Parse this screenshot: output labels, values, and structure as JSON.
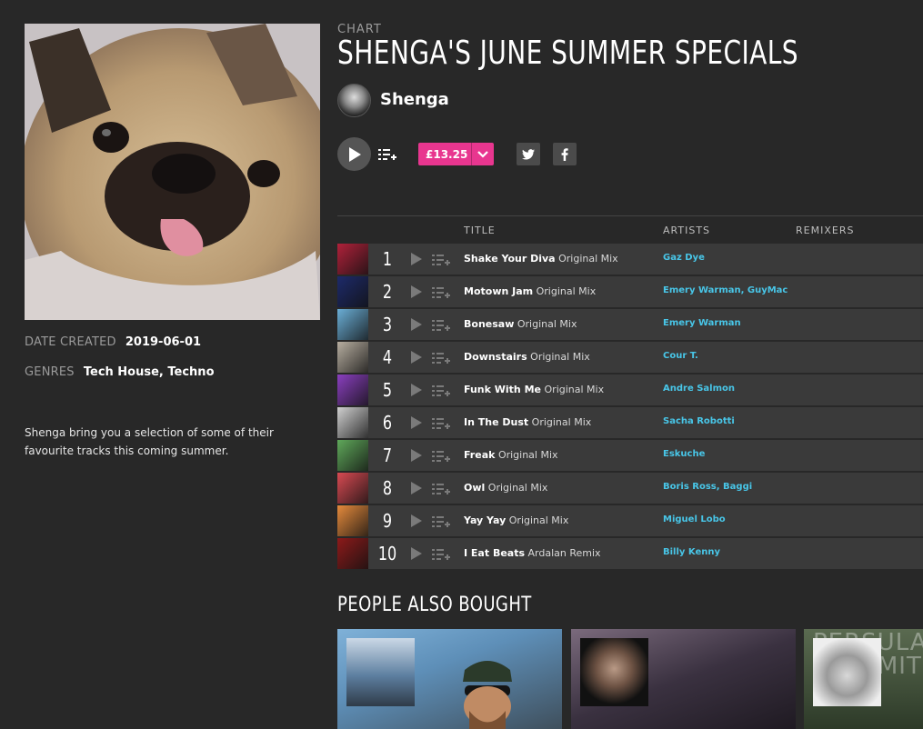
{
  "chart": {
    "kicker": "CHART",
    "title": "SHENGA'S JUNE SUMMER SPECIALS",
    "curator": "Shenga",
    "price": "£13.25"
  },
  "meta": {
    "date_label": "DATE CREATED",
    "date_value": "2019-06-01",
    "genres_label": "GENRES",
    "genres_value": "Tech House, Techno",
    "description": "Shenga bring you a selection of some of their favourite tracks this coming summer."
  },
  "columns": {
    "title": "TITLE",
    "artists": "ARTISTS",
    "remixers": "REMIXERS"
  },
  "tracks": [
    {
      "num": "1",
      "name": "Shake Your Diva",
      "mix": "Original Mix",
      "artists": "Gaz Dye",
      "thumb": "#b0213a"
    },
    {
      "num": "2",
      "name": "Motown Jam",
      "mix": "Original Mix",
      "artists": "Emery Warman, GuyMac",
      "thumb": "#1d2a6a"
    },
    {
      "num": "3",
      "name": "Bonesaw",
      "mix": "Original Mix",
      "artists": "Emery Warman",
      "thumb": "#6aaed6"
    },
    {
      "num": "4",
      "name": "Downstairs",
      "mix": "Original Mix",
      "artists": "Cour T.",
      "thumb": "#b7aea0"
    },
    {
      "num": "5",
      "name": "Funk With Me",
      "mix": "Original Mix",
      "artists": "Andre Salmon",
      "thumb": "#8a3fbf"
    },
    {
      "num": "6",
      "name": "In The Dust",
      "mix": "Original Mix",
      "artists": "Sacha Robotti",
      "thumb": "#d0d0d0"
    },
    {
      "num": "7",
      "name": "Freak",
      "mix": "Original Mix",
      "artists": "Eskuche",
      "thumb": "#5fa85a"
    },
    {
      "num": "8",
      "name": "Owl",
      "mix": "Original Mix",
      "artists": "Boris Ross, Baggi",
      "thumb": "#d84a52"
    },
    {
      "num": "9",
      "name": "Yay Yay",
      "mix": "Original Mix",
      "artists": "Miguel Lobo",
      "thumb": "#e58a3c"
    },
    {
      "num": "10",
      "name": "I Eat Beats",
      "mix": "Ardalan Remix",
      "artists": "Billy Kenny",
      "thumb": "#8c1a1a"
    }
  ],
  "people_also_bought": {
    "title": "PEOPLE ALSO BOUGHT",
    "card3_bg_text": "PERSULA\nOF LIMITS"
  },
  "colors": {
    "accent": "#e8368f",
    "link": "#48c6e8",
    "background": "#282828",
    "row": "#3a3a3a"
  },
  "icons": {
    "play": "play-icon",
    "queue": "add-to-queue-icon",
    "chevron": "chevron-down-icon",
    "twitter": "twitter-icon",
    "facebook": "facebook-icon"
  }
}
